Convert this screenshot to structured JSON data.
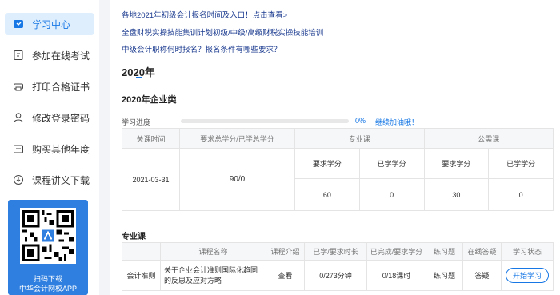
{
  "sidebar": {
    "items": [
      {
        "label": "学习中心",
        "icon": "learning-icon",
        "active": true
      },
      {
        "label": "参加在线考试",
        "icon": "exam-icon",
        "active": false
      },
      {
        "label": "打印合格证书",
        "icon": "printer-icon",
        "active": false
      },
      {
        "label": "修改登录密码",
        "icon": "user-icon",
        "active": false
      },
      {
        "label": "购买其他年度",
        "icon": "cart-icon",
        "active": false
      },
      {
        "label": "课程讲义下载",
        "icon": "download-icon",
        "active": false
      }
    ],
    "qr": {
      "line1": "扫码下载",
      "line2": "中华会计网校APP"
    }
  },
  "links": [
    "各地2021年初级会计报名时间及入口！点击查看>",
    "全盘财税实操技能集训计划初级/中级/高级财税实操技能培训",
    "中级会计职称何时报名？报名条件有哪些要求？"
  ],
  "year": "2020年",
  "subtitle": "2020年企业类",
  "progress": {
    "label": "学习进度",
    "value": 0,
    "pct_text": "0%",
    "cheer": "继续加油哦！"
  },
  "summary_table": {
    "headers": {
      "time": "关课时间",
      "credits": "要求总学分/已学总学分",
      "professional": "专业课",
      "public": "公需课"
    },
    "subheaders": {
      "req": "要求学分",
      "done": "已学学分"
    },
    "row": {
      "time": "2021-03-31",
      "credits": "90/0",
      "pro_req": "60",
      "pro_done": "0",
      "pub_req": "30",
      "pub_done": "0"
    }
  },
  "section_title": "专业课",
  "course_table": {
    "headers": [
      "课程名称",
      "课程介绍",
      "已学/要求时长",
      "已完成/要求学分",
      "练习题",
      "在线答疑",
      "学习状态"
    ],
    "rows": [
      {
        "category": "会计准则",
        "name": "关于企业会计准则国际化趋同的反思及应对方略",
        "intro": "查看",
        "duration": "0/273分钟",
        "credit": "0/18课时",
        "exercise": "练习题",
        "qa": "答疑",
        "status": "开始学习"
      }
    ]
  },
  "colors": {
    "accent": "#1677e5",
    "link": "#1a3a8f",
    "qr_bg": "#2f7fe0"
  }
}
